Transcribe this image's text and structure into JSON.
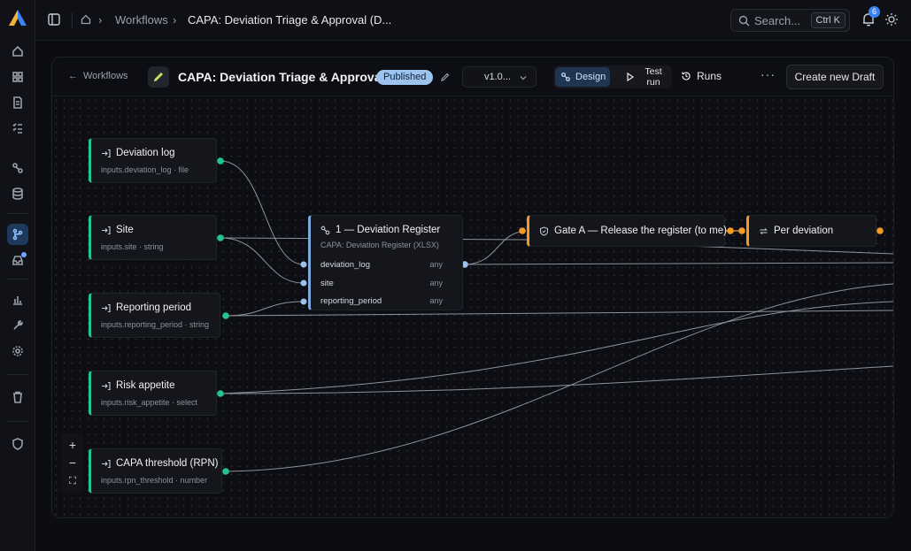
{
  "topbar": {
    "breadcrumbs": [
      "Workflows",
      "CAPA: Deviation Triage & Approval (D..."
    ],
    "search_label": "Search...",
    "search_shortcut": "Ctrl K",
    "notifications_count": "6"
  },
  "toolbar": {
    "back_label": "Workflows",
    "title": "CAPA: Deviation Triage & Approval (...",
    "status": "Published",
    "version": "v1.0...",
    "design_label": "Design",
    "test_label": "Test run",
    "runs_label": "Runs",
    "more_label": "···",
    "create_draft_label": "Create new Draft"
  },
  "inputs": [
    {
      "title": "Deviation log",
      "sub": "inputs.deviation_log · file"
    },
    {
      "title": "Site",
      "sub": "inputs.site · string"
    },
    {
      "title": "Reporting period",
      "sub": "inputs.reporting_period · string"
    },
    {
      "title": "Risk appetite",
      "sub": "inputs.risk_appetite · select"
    },
    {
      "title": "CAPA threshold (RPN)",
      "sub": "inputs.rpn_threshold · number"
    }
  ],
  "register": {
    "title": "1 — Deviation Register",
    "sub": "CAPA: Deviation Register (XLSX)",
    "ports": [
      {
        "name": "deviation_log",
        "type": "any"
      },
      {
        "name": "site",
        "type": "any"
      },
      {
        "name": "reporting_period",
        "type": "any"
      }
    ]
  },
  "gate": {
    "title": "Gate A — Release the register (to me)"
  },
  "loop": {
    "title": "Per deviation"
  },
  "zoom": {
    "in": "+",
    "out": "−",
    "fit": "⛶"
  },
  "colors": {
    "input_accent": "#22c58b",
    "step_accent": "#7ea9df",
    "gate_accent": "#f59a23",
    "link_blue": "#9cc2ee"
  }
}
